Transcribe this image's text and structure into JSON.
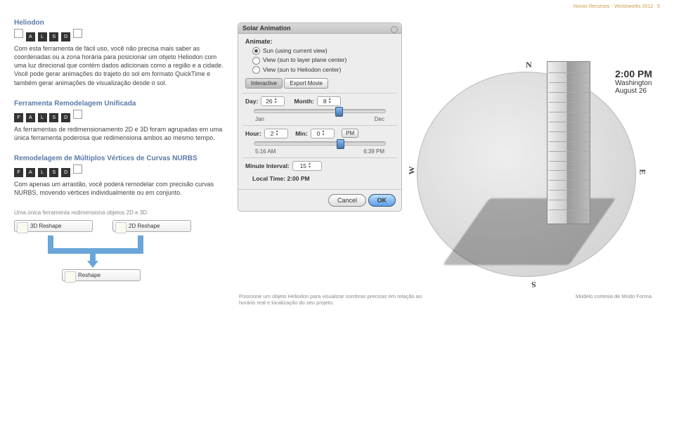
{
  "header": {
    "doc_title": "Novos Recursos - Vectorworks 2012",
    "page_num": "5"
  },
  "heliodon": {
    "title": "Heliodon",
    "badges": [
      "",
      "A",
      "L",
      "S",
      "D",
      ""
    ],
    "text": "Com esta ferramenta de fácil uso, você não precisa mais saber as coordenadas ou a zona horária para posicionar um objeto Heliodon com uma luz direcional que contém dados adicionais como a região e a cidade. Você pode gerar animações do trajeto do sol em formato QuickTime e também gerar animações de visualização desde o sol."
  },
  "reshape": {
    "title": "Ferramenta Remodelagem Unificada",
    "badges": [
      "F",
      "A",
      "L",
      "S",
      "D",
      ""
    ],
    "text": "As ferramentas de redimensionamento 2D e 3D foram agrupadas em uma única ferramenta poderosa que redimensiona ambos ao mesmo tempo."
  },
  "nurbs": {
    "title": "Remodelagem de Múltiplos Vértices de Curvas NURBS",
    "badges": [
      "F",
      "A",
      "L",
      "S",
      "D",
      ""
    ],
    "text": "Com apenas um arrastão, você poderá remodelar com precisão curvas NURBS, movendo vértices individualmente ou em conjunto."
  },
  "reshape_diag": {
    "caption": "Uma única ferramenta redimensiona objetos 2D e 3D.",
    "box_3d": "3D Reshape",
    "box_2d": "2D Reshape",
    "box_merged": "Reshape"
  },
  "panel": {
    "title": "Solar Animation",
    "animate_label": "Animate:",
    "radios": [
      "Sun (using current view)",
      "View (sun to layer plane center)",
      "View (sun to Heliodon center)"
    ],
    "tabs": [
      "Interactive",
      "Export Movie"
    ],
    "day_label": "Day:",
    "day_value": "26",
    "month_label": "Month:",
    "month_value": "8",
    "month_range": [
      "Jan",
      "Dec"
    ],
    "hour_label": "Hour:",
    "hour_value": "2",
    "min_label": "Min:",
    "min_value": "0",
    "ampm": "PM",
    "hour_range": [
      "5:16 AM",
      "6:39 PM"
    ],
    "interval_label": "Minute Interval:",
    "interval_value": "15",
    "local_label": "Local Time:",
    "local_value": "2:00 PM",
    "cancel": "Cancel",
    "ok": "OK"
  },
  "scene": {
    "compass": {
      "n": "N",
      "e": "E",
      "s": "S",
      "w": "W"
    },
    "time_big": "2:00 PM",
    "time_city": "Washington",
    "time_date": "August 26"
  },
  "caption_center": "Posicione um objeto Heliodon para visualizar sombras precisas em relação ao horário real e localização do seu projeto.",
  "caption_right": "Modelo cortesia de Modo Forma."
}
